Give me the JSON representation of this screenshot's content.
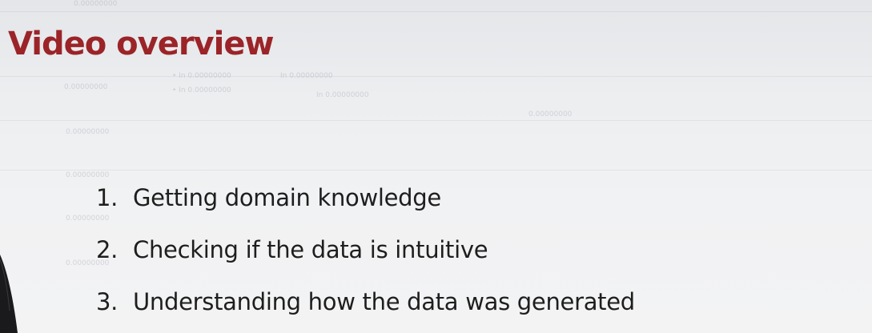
{
  "slide": {
    "title": "Video overview",
    "items": [
      {
        "number": "1.",
        "text": "Getting domain knowledge"
      },
      {
        "number": "2.",
        "text": "Checking if the data is intuitive"
      },
      {
        "number": "3.",
        "text": "Understanding how the data was generated"
      }
    ]
  },
  "colors": {
    "title": "#9b2428",
    "text": "#1e1e1e",
    "background": "#eceef0"
  }
}
